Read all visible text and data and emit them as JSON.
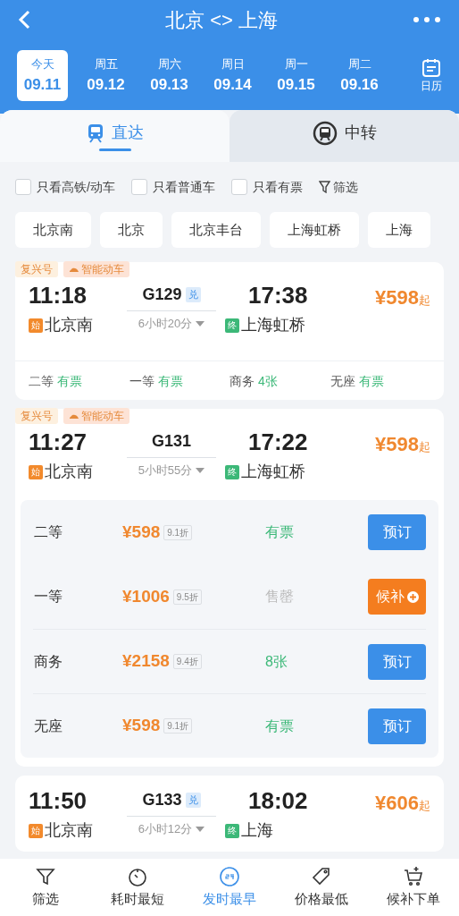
{
  "header": {
    "title": "北京 <> 上海"
  },
  "dates": [
    {
      "weekday": "今天",
      "date": "09.11",
      "selected": true
    },
    {
      "weekday": "周五",
      "date": "09.12",
      "selected": false
    },
    {
      "weekday": "周六",
      "date": "09.13",
      "selected": false
    },
    {
      "weekday": "周日",
      "date": "09.14",
      "selected": false
    },
    {
      "weekday": "周一",
      "date": "09.15",
      "selected": false
    },
    {
      "weekday": "周二",
      "date": "09.16",
      "selected": false
    }
  ],
  "calendar_label": "日历",
  "tabs": [
    {
      "label": "直达",
      "kind": "direct",
      "selected": true
    },
    {
      "label": "中转",
      "kind": "transfer",
      "selected": false
    }
  ],
  "filters": [
    {
      "label": "只看高铁/动车",
      "checked": false
    },
    {
      "label": "只看普通车",
      "checked": false
    },
    {
      "label": "只看有票",
      "checked": false
    }
  ],
  "filter_button": "筛选",
  "stations": [
    "北京南",
    "北京",
    "北京丰台",
    "上海虹桥",
    "上海"
  ],
  "trains": [
    {
      "tags": [
        {
          "label": "复兴号",
          "kind": "plain"
        },
        {
          "label": "智能动车",
          "kind": "smart"
        }
      ],
      "depart": "11:18",
      "train_no": "G129",
      "redeem": "兑",
      "duration": "6小时20分",
      "arrive": "17:38",
      "from_badge": "始",
      "from": "北京南",
      "to_badge": "终",
      "to": "上海虹桥",
      "price": "¥598",
      "price_suffix": "起",
      "expanded": false,
      "seats": [
        {
          "name": "二等",
          "status": "有票"
        },
        {
          "name": "一等",
          "status": "有票"
        },
        {
          "name": "商务",
          "status": "4张"
        },
        {
          "name": "无座",
          "status": "有票"
        }
      ]
    },
    {
      "tags": [
        {
          "label": "复兴号",
          "kind": "plain"
        },
        {
          "label": "智能动车",
          "kind": "smart"
        }
      ],
      "depart": "11:27",
      "train_no": "G131",
      "duration": "5小时55分",
      "arrive": "17:22",
      "from_badge": "始",
      "from": "北京南",
      "to_badge": "终",
      "to": "上海虹桥",
      "price": "¥598",
      "price_suffix": "起",
      "expanded": true,
      "seats": [
        {
          "name": "二等",
          "price": "¥598",
          "discount": "9.1折",
          "status": "有票",
          "available": true,
          "action": "预订",
          "kind": "book"
        },
        {
          "name": "一等",
          "price": "¥1006",
          "discount": "9.5折",
          "status": "售罄",
          "available": false,
          "action": "候补",
          "kind": "waitlist"
        },
        {
          "name": "商务",
          "price": "¥2158",
          "discount": "9.4折",
          "status": "8张",
          "available": true,
          "action": "预订",
          "kind": "book"
        },
        {
          "name": "无座",
          "price": "¥598",
          "discount": "9.1折",
          "status": "有票",
          "available": true,
          "action": "预订",
          "kind": "book"
        }
      ]
    },
    {
      "depart": "11:50",
      "train_no": "G133",
      "redeem": "兑",
      "duration": "6小时12分",
      "arrive": "18:02",
      "from_badge": "始",
      "from": "北京南",
      "to_badge": "终",
      "to": "上海",
      "price": "¥606",
      "price_suffix": "起"
    }
  ],
  "bottom_nav": [
    {
      "label": "筛选",
      "kind": "filter",
      "selected": false
    },
    {
      "label": "耗时最短",
      "kind": "timer",
      "selected": false
    },
    {
      "label": "发时最早",
      "kind": "clock24",
      "selected": true
    },
    {
      "label": "价格最低",
      "kind": "tag",
      "selected": false
    },
    {
      "label": "候补下单",
      "kind": "cart",
      "selected": false
    }
  ]
}
